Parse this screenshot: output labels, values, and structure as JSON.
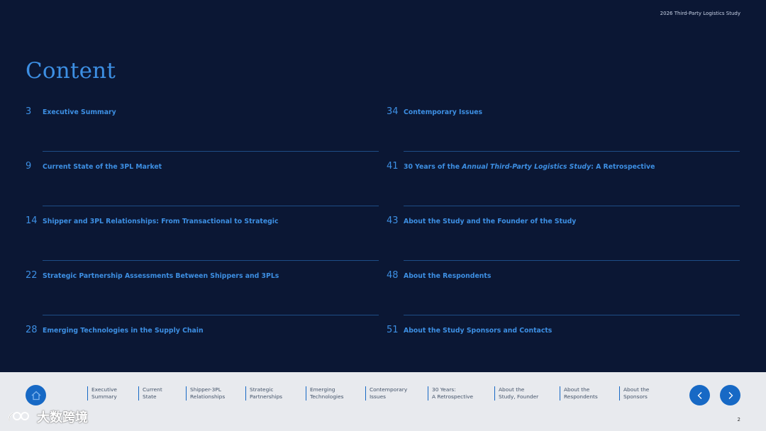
{
  "header": {
    "study_label": "2026 Third-Party Logistics Study"
  },
  "page_title": "Content",
  "toc_left": [
    {
      "page": "3",
      "title": "Executive Summary"
    },
    {
      "page": "9",
      "title": "Current State of the 3PL Market"
    },
    {
      "page": "14",
      "title": "Shipper and 3PL Relationships: From Transactional to Strategic"
    },
    {
      "page": "22",
      "title": "Strategic Partnership Assessments Between Shippers and 3PLs"
    },
    {
      "page": "28",
      "title": "Emerging Technologies in the Supply Chain"
    }
  ],
  "toc_right": [
    {
      "page": "34",
      "title": "Contemporary Issues"
    },
    {
      "page": "41",
      "title_pre": "30 Years of the ",
      "title_italic": "Annual Third-Party Logistics Study",
      "title_post": ": A Retrospective"
    },
    {
      "page": "43",
      "title": "About the Study and the Founder of the Study"
    },
    {
      "page": "48",
      "title": "About the Respondents"
    },
    {
      "page": "51",
      "title": "About the Study Sponsors and Contacts"
    }
  ],
  "footer_nav": [
    {
      "line1": "Executive",
      "line2": "Summary"
    },
    {
      "line1": "Current",
      "line2": "State"
    },
    {
      "line1": "Shipper-3PL",
      "line2": "Relationships"
    },
    {
      "line1": "Strategic",
      "line2": "Partnerships"
    },
    {
      "line1": "Emerging",
      "line2": "Technologies"
    },
    {
      "line1": "Contemporary",
      "line2": "Issues"
    },
    {
      "line1": "30 Years:",
      "line2": "A Retrospective"
    },
    {
      "line1": "About the",
      "line2": "Study, Founder"
    },
    {
      "line1": "About the",
      "line2": "Respondents"
    },
    {
      "line1": "About the",
      "line2": "Sponsors"
    }
  ],
  "icons": {
    "home": "home-icon",
    "prev": "chevron-left-icon",
    "next": "chevron-right-icon"
  },
  "page_number": "2",
  "watermark_text": "大数跨境",
  "colors": {
    "background": "#0b1734",
    "accent": "#3d8fe3",
    "footer_bg": "#e8eaee",
    "button": "#1769c5"
  }
}
